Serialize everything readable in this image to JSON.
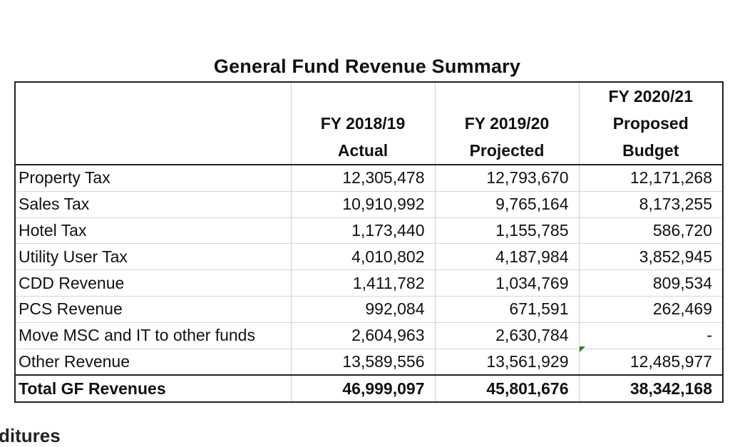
{
  "title": "General Fund Revenue Summary",
  "columns": [
    {
      "line1": "",
      "line2": "FY 2018/19",
      "line3": "Actual"
    },
    {
      "line1": "",
      "line2": "FY 2019/20",
      "line3": "Projected"
    },
    {
      "line1": "FY 2020/21",
      "line2": "Proposed",
      "line3": "Budget"
    }
  ],
  "rows": [
    {
      "label": "Property Tax",
      "v1": "12,305,478",
      "v2": "12,793,670",
      "v3": "12,171,268"
    },
    {
      "label": "Sales Tax",
      "v1": "10,910,992",
      "v2": "9,765,164",
      "v3": "8,173,255"
    },
    {
      "label": "Hotel Tax",
      "v1": "1,173,440",
      "v2": "1,155,785",
      "v3": "586,720"
    },
    {
      "label": "Utility User Tax",
      "v1": "4,010,802",
      "v2": "4,187,984",
      "v3": "3,852,945"
    },
    {
      "label": "CDD Revenue",
      "v1": "1,411,782",
      "v2": "1,034,769",
      "v3": "809,534"
    },
    {
      "label": "PCS Revenue",
      "v1": "992,084",
      "v2": "671,591",
      "v3": "262,469"
    },
    {
      "label": "Move MSC and IT to other funds",
      "v1": "2,604,963",
      "v2": "2,630,784",
      "v3": "-"
    },
    {
      "label": "Other Revenue",
      "v1": "13,589,556",
      "v2": "13,561,929",
      "v3": "12,485,977"
    }
  ],
  "total": {
    "label": "Total GF Revenues",
    "v1": "46,999,097",
    "v2": "45,801,676",
    "v3": "38,342,168"
  },
  "cut_text": "ditures",
  "colors": {
    "border": "#222222",
    "gridline": "#d0d0d0",
    "marker": "#1a8a1a"
  }
}
